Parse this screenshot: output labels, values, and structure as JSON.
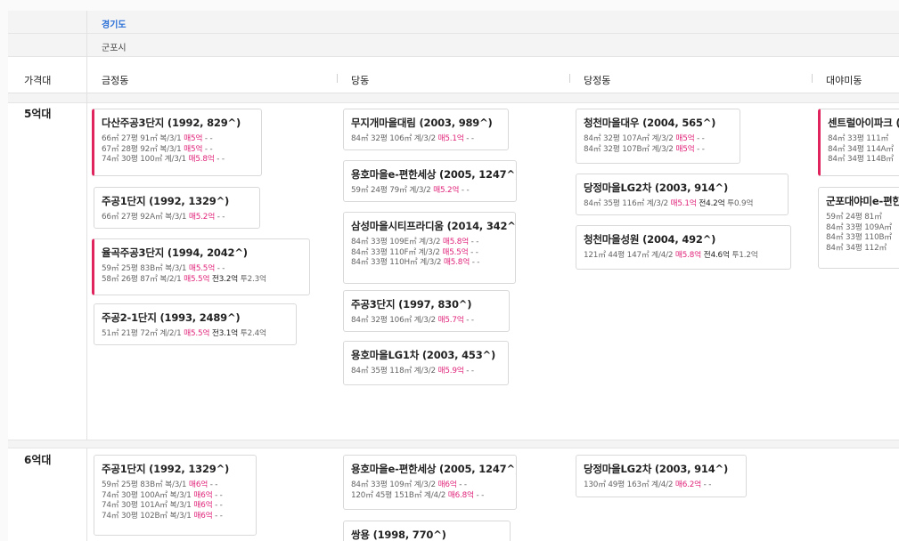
{
  "region": {
    "province": "경기도",
    "city": "군포시"
  },
  "header": {
    "price_band_label": "가격대",
    "dongs": [
      "금정동",
      "당동",
      "당정동",
      "대야미동"
    ]
  },
  "bands": [
    {
      "label": "5억대",
      "cards": [
        {
          "title": "다산주공3단지 (1992, 829^)",
          "lines": [
            {
              "info": "66㎡ 27평 91㎡ 복/3/1",
              "sale": "매5억",
              "tail": "- -"
            },
            {
              "info": "67㎡ 28평 92㎡ 복/3/1",
              "sale": "매5억",
              "tail": "- -"
            },
            {
              "info": "74㎡ 30평 100㎡ 계/3/1",
              "sale": "매5.8억",
              "tail": "- -"
            }
          ]
        },
        {
          "title": "주공1단지 (1992, 1329^)",
          "lines": [
            {
              "info": "66㎡ 27평 92A㎡ 복/3/1",
              "sale": "매5.2억",
              "tail": "- -"
            }
          ]
        },
        {
          "title": "율곡주공3단지 (1994, 2042^)",
          "lines": [
            {
              "info": "59㎡ 25평 83B㎡ 복/3/1",
              "sale": "매5.5억",
              "tail": "- -"
            },
            {
              "info": "58㎡ 26평 87㎡ 복/2/1",
              "sale": "매5.5억",
              "jeonse": "전3.2억",
              "tail": "투2.3억"
            }
          ]
        },
        {
          "title": "주공2-1단지 (1993, 2489^)",
          "lines": [
            {
              "info": "51㎡ 21평 72㎡ 계/2/1",
              "sale": "매5.5억",
              "jeonse": "전3.1억",
              "tail": "투2.4억"
            }
          ]
        },
        {
          "title": "무지개마을대림 (2003, 989^)",
          "lines": [
            {
              "info": "84㎡ 32평 106㎡ 계/3/2",
              "sale": "매5.1억",
              "tail": "- -"
            }
          ]
        },
        {
          "title": "용호마을e-편한세상 (2005, 1247^)",
          "lines": [
            {
              "info": "59㎡ 24평 79㎡ 계/3/2",
              "sale": "매5.2억",
              "tail": "- -"
            }
          ]
        },
        {
          "title": "삼성마을시티프라디움 (2014, 342^)",
          "lines": [
            {
              "info": "84㎡ 33평 109E㎡ 계/3/2",
              "sale": "매5.8억",
              "tail": "- -"
            },
            {
              "info": "84㎡ 33평 110F㎡ 계/3/2",
              "sale": "매5.5억",
              "tail": "- -"
            },
            {
              "info": "84㎡ 33평 110H㎡ 계/3/2",
              "sale": "매5.8억",
              "tail": "- -"
            }
          ]
        },
        {
          "title": "주공3단지 (1997, 830^)",
          "lines": [
            {
              "info": "84㎡ 32평 106㎡ 계/3/2",
              "sale": "매5.7억",
              "tail": "- -"
            }
          ]
        },
        {
          "title": "용호마을LG1차 (2003, 453^)",
          "lines": [
            {
              "info": "84㎡ 35평 118㎡ 계/3/2",
              "sale": "매5.9억",
              "tail": "- -"
            }
          ]
        },
        {
          "title": "청천마을대우 (2004, 565^)",
          "lines": [
            {
              "info": "84㎡ 32평 107A㎡ 계/3/2",
              "sale": "매5억",
              "tail": "- -"
            },
            {
              "info": "84㎡ 32평 107B㎡ 계/3/2",
              "sale": "매5억",
              "tail": "- -"
            }
          ]
        },
        {
          "title": "당정마을LG2차 (2003, 914^)",
          "lines": [
            {
              "info": "84㎡ 35평 116㎡ 계/3/2",
              "sale": "매5.1억",
              "jeonse": "전4.2억",
              "tail": "투0.9억"
            }
          ]
        },
        {
          "title": "청천마을성원 (2004, 492^)",
          "lines": [
            {
              "info": "121㎡ 44평 147㎡ 계/4/2",
              "sale": "매5.8억",
              "jeonse": "전4.6억",
              "tail": "투1.2억"
            }
          ]
        },
        {
          "title": "센트럴아이파크 (2",
          "lines": [
            {
              "info": "84㎡ 33평 111㎡"
            },
            {
              "info": "84㎡ 34평 114A㎡"
            },
            {
              "info": "84㎡ 34평 114B㎡"
            }
          ]
        },
        {
          "title": "군포대야미e-편한",
          "lines": [
            {
              "info": "59㎡ 24평 81㎡"
            },
            {
              "info": "84㎡ 33평 109A㎡"
            },
            {
              "info": "84㎡ 33평 110B㎡"
            },
            {
              "info": "84㎡ 34평 112㎡"
            }
          ]
        }
      ]
    },
    {
      "label": "6억대",
      "cards": [
        {
          "title": "주공1단지 (1992, 1329^)",
          "lines": [
            {
              "info": "59㎡ 25평 83B㎡ 복/3/1",
              "sale": "매6억",
              "tail": "- -"
            },
            {
              "info": "74㎡ 30평 100A㎡ 복/3/1",
              "sale": "매6억",
              "tail": "- -"
            },
            {
              "info": "74㎡ 30평 101A㎡ 복/3/1",
              "sale": "매6억",
              "tail": "- -"
            },
            {
              "info": "74㎡ 30평 102B㎡ 복/3/1",
              "sale": "매6억",
              "tail": "- -"
            }
          ]
        },
        {
          "title": "용호마을e-편한세상 (2005, 1247^)",
          "lines": [
            {
              "info": "84㎡ 33평 109㎡ 계/3/2",
              "sale": "매6억",
              "tail": "- -"
            },
            {
              "info": "120㎡ 45평 151B㎡ 계/4/2",
              "sale": "매6.8억",
              "tail": "- -"
            }
          ]
        },
        {
          "title": "쌍용 (1998, 770^)",
          "lines": []
        },
        {
          "title": "당정마을LG2차 (2003, 914^)",
          "lines": [
            {
              "info": "130㎡ 49평 163㎡ 계/4/2",
              "sale": "매6.2억",
              "tail": "- -"
            }
          ]
        }
      ]
    }
  ]
}
